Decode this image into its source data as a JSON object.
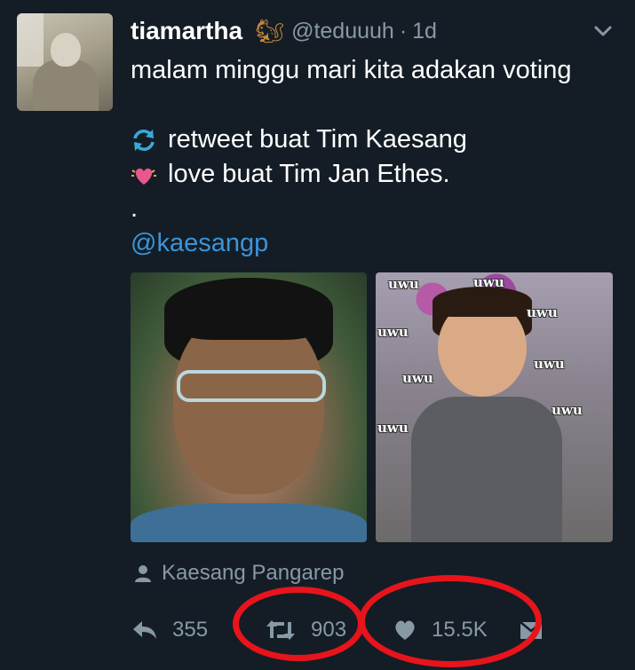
{
  "tweet": {
    "author": {
      "display_name": "tiamartha",
      "emoji_icon": "squirrel-icon",
      "handle": "@teduuuh",
      "separator": "·",
      "age": "1d"
    },
    "lines": [
      "malam minggu mari kita adakan voting",
      "",
      "retweet buat Tim Kaesang",
      "love buat Tim Jan Ethes.",
      "."
    ],
    "mention": "@kaesangp",
    "media": {
      "left_image": "boy-with-glasses-photo",
      "right_image": "toddler-with-uwu-text-photo",
      "uwu_labels": [
        "uwu",
        "uwu",
        "uwu",
        "uwu",
        "uwu",
        "uwu",
        "uwu",
        "uwu"
      ]
    },
    "attribution": "Kaesang Pangarep",
    "actions": {
      "reply_count": "355",
      "retweet_count": "903",
      "like_count": "15.5K"
    }
  },
  "colors": {
    "background": "#141d26",
    "muted_text": "#8899a6",
    "link": "#3b94d9",
    "retweet_icon": "#3ba9d8",
    "heart_icon": "#e8578f",
    "annotation_circle": "#e8141b"
  }
}
